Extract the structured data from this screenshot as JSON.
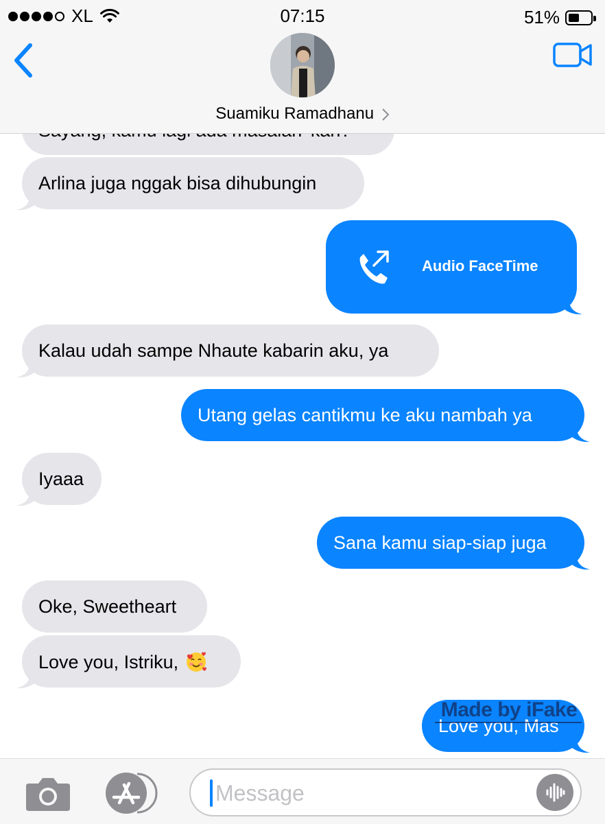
{
  "status_bar": {
    "carrier": "XL",
    "time": "07:15",
    "battery": "51%",
    "battery_level": 0.51
  },
  "header": {
    "contact_name": "Suamiku Ramadhanu",
    "chevron": ">"
  },
  "messages": [
    {
      "side": "received",
      "text": "Sayang, kamu lagi ada masalah 'kan?"
    },
    {
      "side": "received",
      "text": "Arlina juga nggak bisa dihubungin"
    },
    {
      "side": "sent",
      "type": "facetime",
      "text": "Audio FaceTime"
    },
    {
      "side": "received",
      "text": "Kalau udah sampe Nhaute kabarin aku, ya"
    },
    {
      "side": "sent",
      "text": "Utang gelas cantikmu ke aku nambah ya"
    },
    {
      "side": "received",
      "text": "Iyaaa"
    },
    {
      "side": "sent",
      "text": "Sana kamu siap-siap juga"
    },
    {
      "side": "received",
      "text": "Oke, Sweetheart"
    },
    {
      "side": "received",
      "text": "Love you, Istriku,",
      "emoji": "smiling-face-with-hearts"
    },
    {
      "side": "sent",
      "text": "Love you, Mas"
    }
  ],
  "watermark": "Made by iFake",
  "input": {
    "placeholder": "Message"
  },
  "colors": {
    "sent_bubble": "#0a84ff",
    "received_bubble": "#e5e5ea",
    "accent": "#0a84ff"
  },
  "icons": {
    "back": "chevron-left-icon",
    "video": "video-camera-icon",
    "camera": "camera-icon",
    "apps": "app-store-icon",
    "audio": "audio-waveform-icon",
    "facetime": "phone-outgoing-icon"
  }
}
